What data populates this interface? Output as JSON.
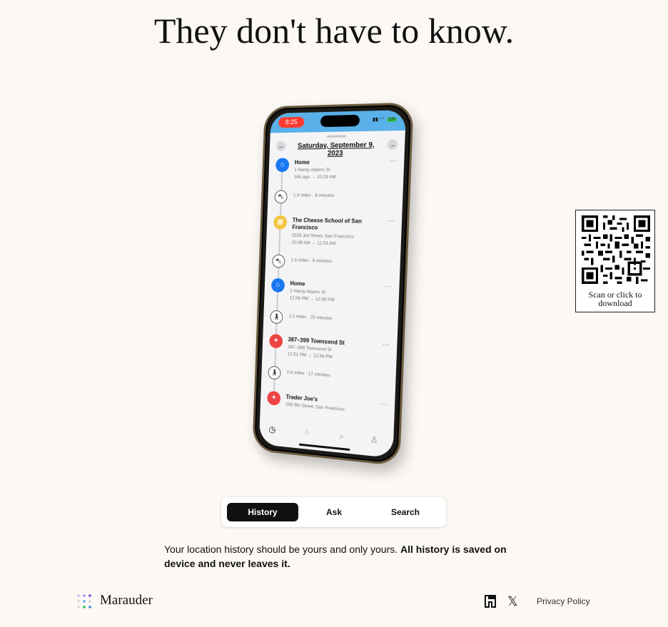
{
  "headline": "They don't have to know.",
  "phone": {
    "status_time": "8:25",
    "battery": "100",
    "date_title": "Saturday, September 9, 2023",
    "stops": [
      {
        "title": "Home",
        "line1": "1 Henry Adams St",
        "line2": "16h ago → 10:29 AM",
        "icon": "home-icon"
      },
      {
        "transit": "1.9 miles · 8 minutes",
        "icon": "car-icon"
      },
      {
        "title": "The Cheese School of San Francisco",
        "line1": "2535 3rd Street, San Francisco",
        "line2": "10:38 AM → 11:53 AM",
        "icon": "building-icon"
      },
      {
        "transit": "1.6 miles · 8 minutes",
        "icon": "car-icon"
      },
      {
        "title": "Home",
        "line1": "1 Henry Adams St",
        "line2": "12:06 PM → 12:39 PM",
        "icon": "home-icon"
      },
      {
        "transit": "1.1 miles · 25 minutes",
        "icon": "walk-icon"
      },
      {
        "title": "387–399 Townsend St",
        "line1": "387–399 Townsend St",
        "line2": "12:51 PM → 12:58 PM",
        "icon": "pin-icon"
      },
      {
        "transit": "0.8 miles · 17 minutes",
        "icon": "walk-icon"
      },
      {
        "title": "Trader Joe's",
        "line1": "555 9th Street, San Francisco",
        "line2": "",
        "icon": "pin-icon"
      }
    ]
  },
  "qr": {
    "caption": "Scan or click to download"
  },
  "tabs": [
    {
      "label": "History",
      "active": true
    },
    {
      "label": "Ask",
      "active": false
    },
    {
      "label": "Search",
      "active": false
    }
  ],
  "description": {
    "normal": "Your location history should be yours and only yours. ",
    "bold": "All history is saved on device and never leaves it."
  },
  "footer": {
    "brand": "Marauder",
    "privacy": "Privacy Policy",
    "icons": [
      "farcaster-icon",
      "x-icon"
    ]
  }
}
